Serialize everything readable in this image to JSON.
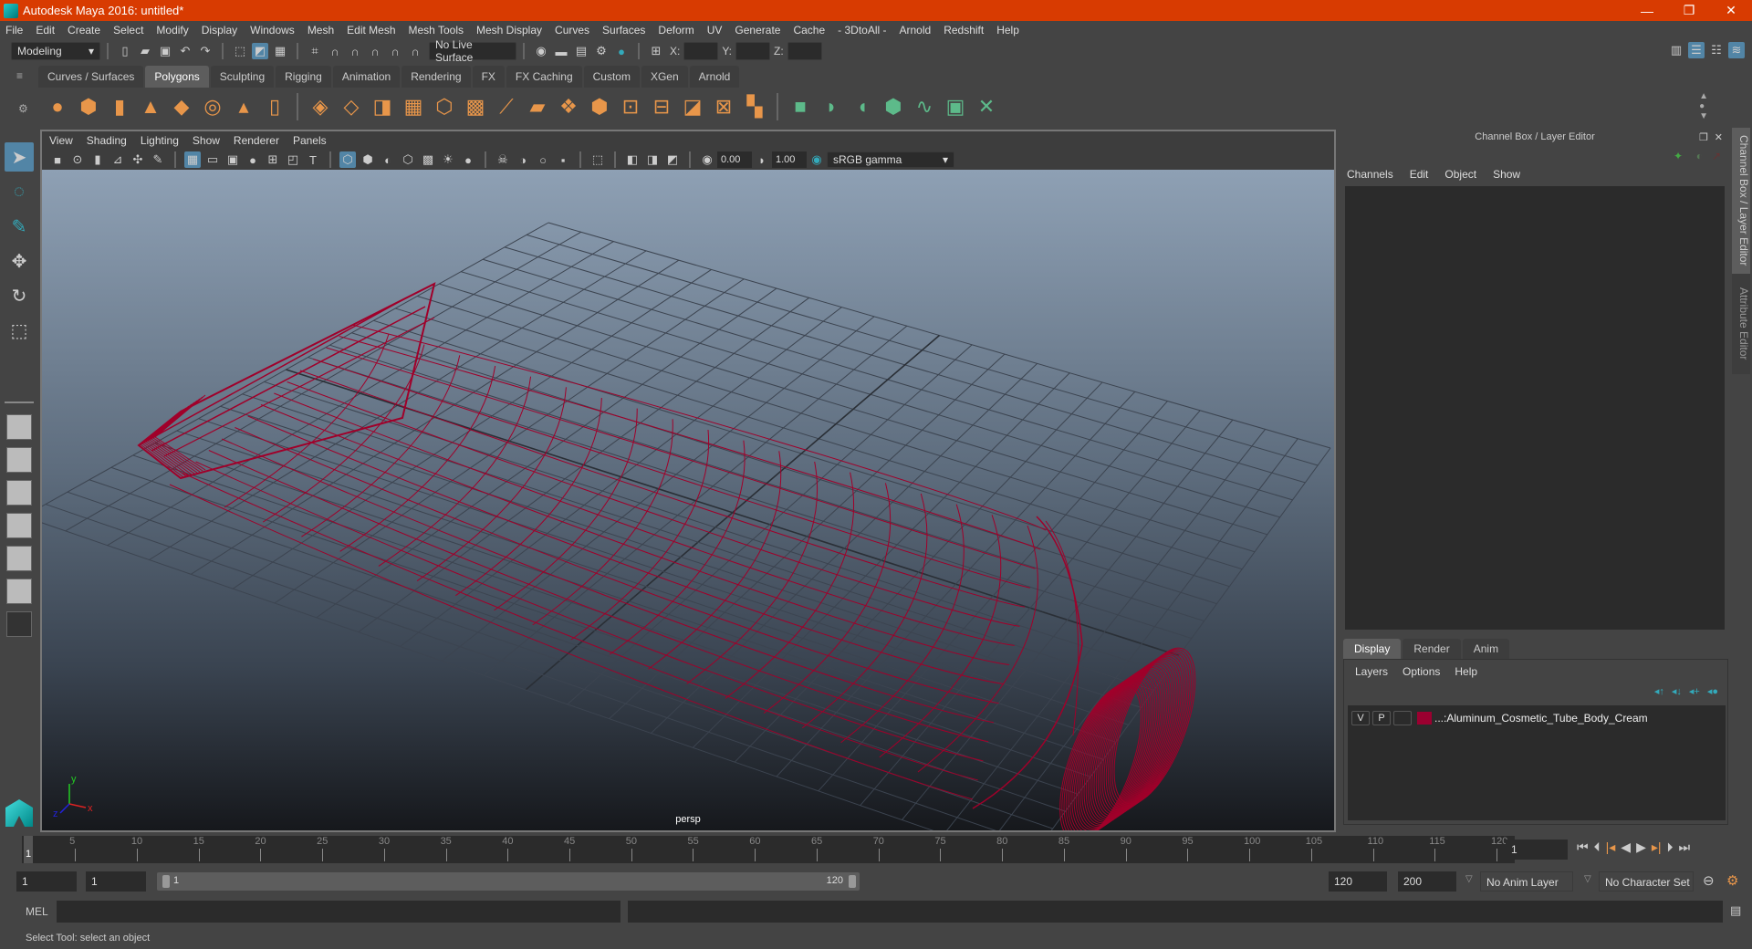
{
  "title": "Autodesk Maya 2016: untitled*",
  "window_controls": {
    "minimize": "—",
    "restore": "❐",
    "close": "✕"
  },
  "menu": [
    "File",
    "Edit",
    "Create",
    "Select",
    "Modify",
    "Display",
    "Windows",
    "Mesh",
    "Edit Mesh",
    "Mesh Tools",
    "Mesh Display",
    "Curves",
    "Surfaces",
    "Deform",
    "UV",
    "Generate",
    "Cache",
    "- 3DtoAll -",
    "Arnold",
    "Redshift",
    "Help"
  ],
  "status_line": {
    "mode": "Modeling",
    "live_surface": "No Live Surface",
    "x_label": "X:",
    "y_label": "Y:",
    "z_label": "Z:"
  },
  "shelf_tabs": [
    "Curves / Surfaces",
    "Polygons",
    "Sculpting",
    "Rigging",
    "Animation",
    "Rendering",
    "FX",
    "FX Caching",
    "Custom",
    "XGen",
    "Arnold"
  ],
  "shelf_active": "Polygons",
  "viewport": {
    "menu": [
      "View",
      "Shading",
      "Lighting",
      "Show",
      "Renderer",
      "Panels"
    ],
    "exposure": "0.00",
    "gamma": "1.00",
    "color_space": "sRGB gamma",
    "camera": "persp",
    "colors": {
      "wireframe": "#a0002a",
      "grid": "#3c4450"
    }
  },
  "channel_box": {
    "title": "Channel Box / Layer Editor",
    "menu": [
      "Channels",
      "Edit",
      "Object",
      "Show"
    ]
  },
  "layer_editor": {
    "tabs": [
      "Display",
      "Render",
      "Anim"
    ],
    "active_tab": "Display",
    "menu": [
      "Layers",
      "Options",
      "Help"
    ],
    "layers": [
      {
        "v": "V",
        "p": "P",
        "color": "#9b0030",
        "name": "...:Aluminum_Cosmetic_Tube_Body_Cream"
      }
    ]
  },
  "side_tabs": [
    "Channel Box / Layer Editor",
    "Attribute Editor"
  ],
  "timeline": {
    "ticks": [
      "5",
      "10",
      "15",
      "20",
      "25",
      "30",
      "35",
      "40",
      "45",
      "50",
      "55",
      "60",
      "65",
      "70",
      "75",
      "80",
      "85",
      "90",
      "95",
      "100",
      "105",
      "110",
      "115",
      "120"
    ],
    "current_frame": "1",
    "start": 1,
    "end": 120
  },
  "range": {
    "start": "1",
    "playback_start": "1",
    "slider_start": "1",
    "slider_end": "120",
    "playback_end": "120",
    "end": "200",
    "anim_layer": "No Anim Layer",
    "character_set": "No Character Set"
  },
  "command_line": {
    "label": "MEL"
  },
  "help_line": "Select Tool: select an object"
}
